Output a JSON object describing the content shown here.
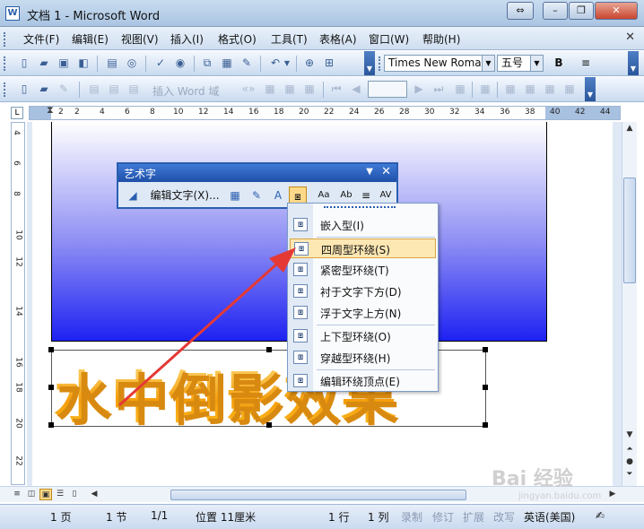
{
  "window": {
    "title": "文档 1 - Microsoft Word",
    "icon_text": "W",
    "buttons": [
      "⇔",
      "–",
      "❐",
      "✕"
    ]
  },
  "menubar": {
    "items": [
      "文件(F)",
      "编辑(E)",
      "视图(V)",
      "插入(I)",
      "格式(O)",
      "工具(T)",
      "表格(A)",
      "窗口(W)",
      "帮助(H)"
    ],
    "close_doc": "✕"
  },
  "toolbar1": {
    "font_name": "Times New Roman",
    "font_size": "五号",
    "bold_label": "B",
    "align_icon": "align-center-icon"
  },
  "toolbar2": {
    "insert_field_label": "插入 Word 域"
  },
  "ruler": {
    "ticks": [
      "2",
      "2",
      "4",
      "6",
      "8",
      "10",
      "12",
      "14",
      "16",
      "18",
      "20",
      "22",
      "24",
      "26",
      "28",
      "30",
      "32",
      "34",
      "36",
      "38",
      "40",
      "42",
      "44"
    ],
    "vticks": [
      "4",
      "6",
      "8",
      "10",
      "12",
      "14",
      "16",
      "18",
      "20",
      "22"
    ]
  },
  "document": {
    "wordart_text": "水中倒影效果"
  },
  "wordart_toolbar": {
    "title": "艺术字",
    "dropdown": "▼",
    "close": "✕",
    "edit_text_label": "编辑文字(X)..."
  },
  "wrap_menu": {
    "items": [
      {
        "label": "嵌入型(I)",
        "icon": "inline-wrap-icon"
      },
      {
        "label": "四周型环绕(S)",
        "icon": "square-wrap-icon"
      },
      {
        "label": "紧密型环绕(T)",
        "icon": "tight-wrap-icon"
      },
      {
        "label": "衬于文字下方(D)",
        "icon": "behind-text-icon"
      },
      {
        "label": "浮于文字上方(N)",
        "icon": "in-front-text-icon"
      },
      {
        "label": "上下型环绕(O)",
        "icon": "top-bottom-wrap-icon"
      },
      {
        "label": "穿越型环绕(H)",
        "icon": "through-wrap-icon"
      },
      {
        "label": "编辑环绕顶点(E)",
        "icon": "edit-wrap-points-icon"
      }
    ],
    "highlighted_index": 1
  },
  "statusbar": {
    "page": "1 页",
    "section": "1 节",
    "pages": "1/1",
    "position": "位置  11厘米",
    "line": "1 行",
    "column": "1 列",
    "rec": "录制",
    "trk": "修订",
    "ext": "扩展",
    "ovr": "改写",
    "language": "英语(美国)"
  },
  "watermark": {
    "text": "Bai 经验",
    "sub": "jingyan.baidu.com"
  }
}
